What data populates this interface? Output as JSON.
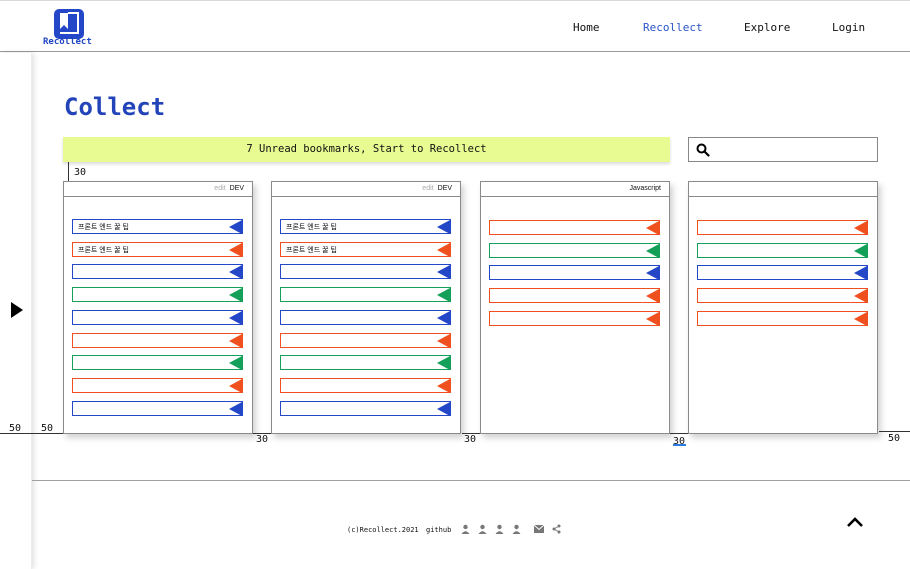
{
  "header": {
    "logo_text": "Recollect",
    "nav": [
      "Home",
      "Recollect",
      "Explore",
      "Login"
    ],
    "active_nav": "Recollect"
  },
  "page": {
    "title": "Collect",
    "banner_text": "7 Unread bookmarks, Start to Recollect",
    "search": {
      "value": "",
      "placeholder": ""
    }
  },
  "annotations": {
    "top_gap": "30",
    "left_outer": "50",
    "left_inner": "50",
    "gap1": "30",
    "gap2": "30",
    "gap3": "30",
    "right_outer": "50"
  },
  "cards": [
    {
      "edit": "edit",
      "tag": "DEV",
      "items": [
        {
          "label": "프론트 엔드 꿀 팁",
          "color": "#2447c8"
        },
        {
          "label": "프론트 엔드 꿀 팁",
          "color": "#f0501e"
        },
        {
          "label": "",
          "color": "#2447c8"
        },
        {
          "label": "",
          "color": "#15a05a"
        },
        {
          "label": "",
          "color": "#2447c8"
        },
        {
          "label": "",
          "color": "#f0501e"
        },
        {
          "label": "",
          "color": "#15a05a"
        },
        {
          "label": "",
          "color": "#f0501e"
        },
        {
          "label": "",
          "color": "#2447c8"
        }
      ]
    },
    {
      "edit": "edit",
      "tag": "DEV",
      "items": [
        {
          "label": "프론트 엔드 꿀 팁",
          "color": "#2447c8"
        },
        {
          "label": "프론트 엔드 꿀 팁",
          "color": "#f0501e"
        },
        {
          "label": "",
          "color": "#2447c8"
        },
        {
          "label": "",
          "color": "#15a05a"
        },
        {
          "label": "",
          "color": "#2447c8"
        },
        {
          "label": "",
          "color": "#f0501e"
        },
        {
          "label": "",
          "color": "#15a05a"
        },
        {
          "label": "",
          "color": "#f0501e"
        },
        {
          "label": "",
          "color": "#2447c8"
        }
      ]
    },
    {
      "edit": "",
      "tag": "Javascript",
      "items": [
        {
          "label": "",
          "color": "#f0501e"
        },
        {
          "label": "",
          "color": "#15a05a"
        },
        {
          "label": "",
          "color": "#2447c8"
        },
        {
          "label": "",
          "color": "#f0501e"
        },
        {
          "label": "",
          "color": "#f0501e"
        }
      ]
    },
    {
      "edit": "",
      "tag": "",
      "items": [
        {
          "label": "",
          "color": "#f0501e"
        },
        {
          "label": "",
          "color": "#15a05a"
        },
        {
          "label": "",
          "color": "#2447c8"
        },
        {
          "label": "",
          "color": "#f0501e"
        },
        {
          "label": "",
          "color": "#f0501e"
        }
      ]
    }
  ],
  "footer": {
    "copyright": "(c)Recollect.2021",
    "github": "github",
    "icons": [
      "person-icon",
      "person-icon",
      "person-icon",
      "person-icon",
      "mail-icon",
      "share-icon"
    ]
  }
}
